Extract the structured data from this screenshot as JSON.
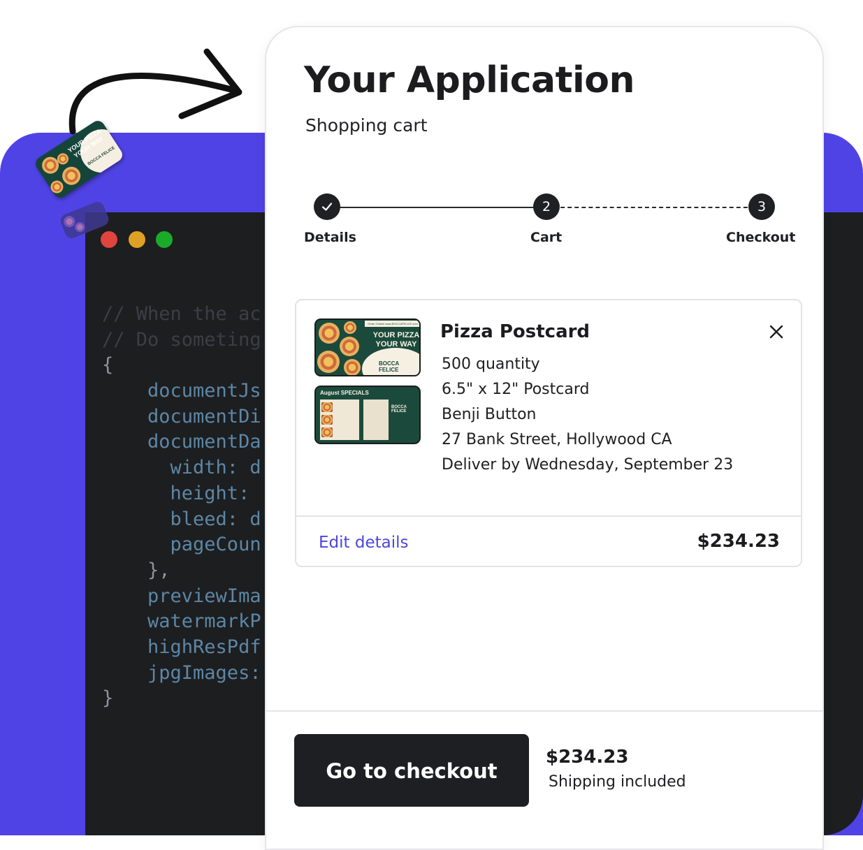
{
  "app": {
    "title": "Your Application",
    "subtitle": "Shopping cart"
  },
  "stepper": {
    "steps": [
      {
        "number": "1",
        "label": "Details",
        "status": "completed"
      },
      {
        "number": "2",
        "label": "Cart",
        "status": "current"
      },
      {
        "number": "3",
        "label": "Checkout",
        "status": "upcoming"
      }
    ]
  },
  "cart_item": {
    "name": "Pizza Postcard",
    "details": [
      "500 quantity",
      "6.5\" x 12\" Postcard",
      "Benji Button",
      "27 Bank Street, Hollywood CA",
      "Deliver by Wednesday, September 23"
    ],
    "edit_label": "Edit details",
    "price": "$234.23",
    "thumbnail_front": {
      "title_line1": "YOUR PIZZA",
      "title_line2": "YOUR WAY",
      "brand": "BOCCA FELICE",
      "band": "Order Online! www.BOCCAFELICE.com"
    },
    "thumbnail_back": {
      "title": "August SPECIALS",
      "brand": "BOCCA FELICE"
    }
  },
  "footer": {
    "checkout_label": "Go to checkout",
    "total": "$234.23",
    "shipping_note": "Shipping included"
  },
  "code_window": {
    "lines": [
      {
        "text": "// When the ac",
        "type": "comment"
      },
      {
        "text": "// Do someting",
        "type": "comment"
      },
      {
        "text": "{",
        "type": "brace"
      },
      {
        "text": "    documentJs",
        "type": "key"
      },
      {
        "text": "    documentDi",
        "type": "key"
      },
      {
        "text": "    documentDa",
        "type": "key"
      },
      {
        "text": "      width: d",
        "type": "key"
      },
      {
        "text": "      height: ",
        "type": "key"
      },
      {
        "text": "      bleed: d",
        "type": "key"
      },
      {
        "text": "      pageCoun",
        "type": "key"
      },
      {
        "text": "    },",
        "type": "brace"
      },
      {
        "text": "    previewIma",
        "type": "key"
      },
      {
        "text": "    watermarkP",
        "type": "key"
      },
      {
        "text": "    highResPdf",
        "type": "key"
      },
      {
        "text": "    jpgImages:",
        "type": "key"
      },
      {
        "text": "}",
        "type": "brace"
      }
    ]
  },
  "sticker": {
    "title": "YOUR PIZZA YOUR WAY",
    "brand": "BOCCA FELICE"
  },
  "colors": {
    "accent": "#5043e6",
    "link": "#4b45e0",
    "dark": "#1e1f22",
    "code_bg": "#1d1e20"
  }
}
